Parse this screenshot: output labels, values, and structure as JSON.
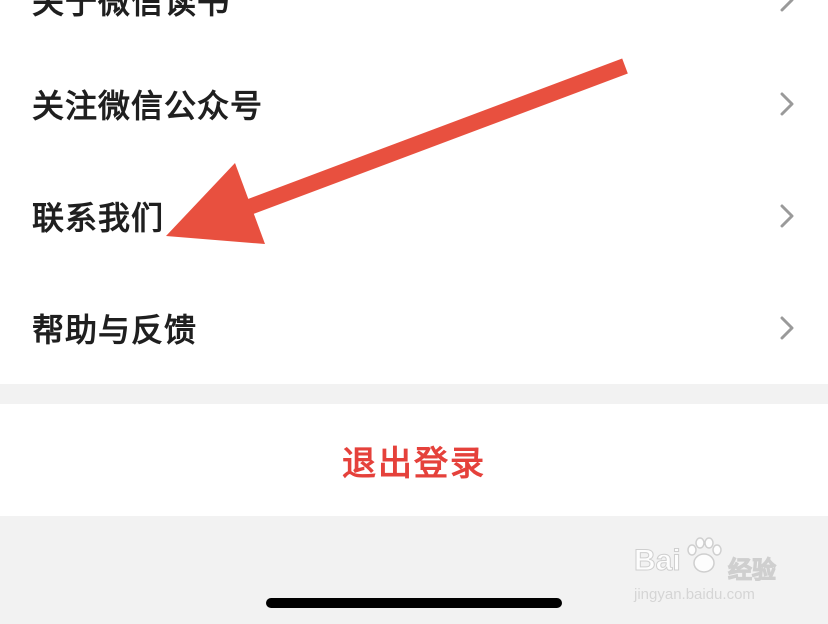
{
  "menu": {
    "items": [
      {
        "label": "关于微信读书",
        "partial": true
      },
      {
        "label": "关注微信公众号"
      },
      {
        "label": "联系我们"
      },
      {
        "label": "帮助与反馈"
      }
    ]
  },
  "logout": {
    "label": "退出登录",
    "color": "#e5413b"
  },
  "annotation": {
    "arrow_color": "#e8503f"
  },
  "watermark": {
    "brand": "Bai",
    "brand_suffix": "经验",
    "domain": "jingyan.baidu.com"
  },
  "icons": {
    "row_chevron": "chevron-right-icon",
    "watermark_logo": "paw-icon"
  }
}
